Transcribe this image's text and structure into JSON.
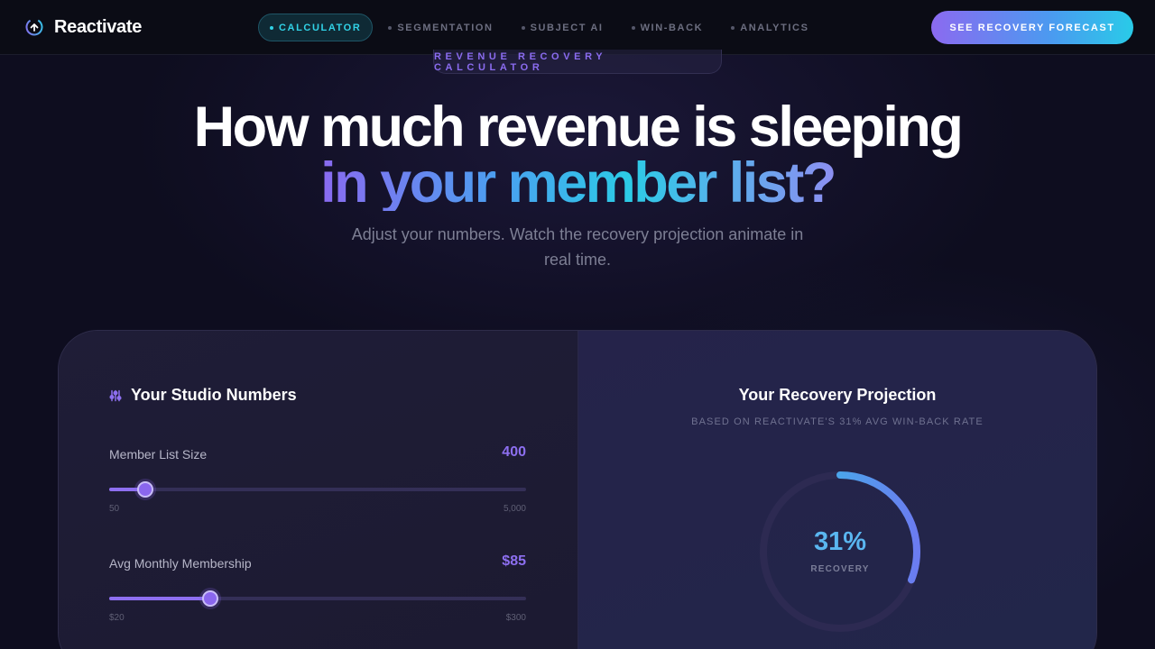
{
  "brand": {
    "name": "Reactivate"
  },
  "nav": {
    "items": [
      {
        "label": "CALCULATOR",
        "active": true
      },
      {
        "label": "SEGMENTATION",
        "active": false
      },
      {
        "label": "SUBJECT AI",
        "active": false
      },
      {
        "label": "WIN-BACK",
        "active": false
      },
      {
        "label": "ANALYTICS",
        "active": false
      }
    ]
  },
  "cta": {
    "label": "SEE RECOVERY FORECAST"
  },
  "hero": {
    "eyebrow": "REVENUE RECOVERY CALCULATOR",
    "headline_line1": "How much revenue is sleeping",
    "headline_line2": "in your member list?",
    "subheadline": "Adjust your numbers. Watch the recovery projection animate in real time."
  },
  "inputs": {
    "title": "Your Studio Numbers",
    "fields": [
      {
        "label": "Member List Size",
        "value": "400",
        "min_label": "50",
        "max_label": "5,000",
        "level": 0.087
      },
      {
        "label": "Avg Monthly Membership",
        "value": "$85",
        "min_label": "$20",
        "max_label": "$300",
        "level": 0.243
      }
    ]
  },
  "projection": {
    "title": "Your Recovery Projection",
    "subtitle": "BASED ON REACTIVATE'S 31% AVG WIN-BACK RATE",
    "percent": "31%",
    "percent_label": "RECOVERY",
    "fraction": 0.31
  },
  "colors": {
    "accent_purple": "#8b6af0",
    "accent_cyan": "#2ccbe6",
    "background": "#0e0d1f"
  }
}
